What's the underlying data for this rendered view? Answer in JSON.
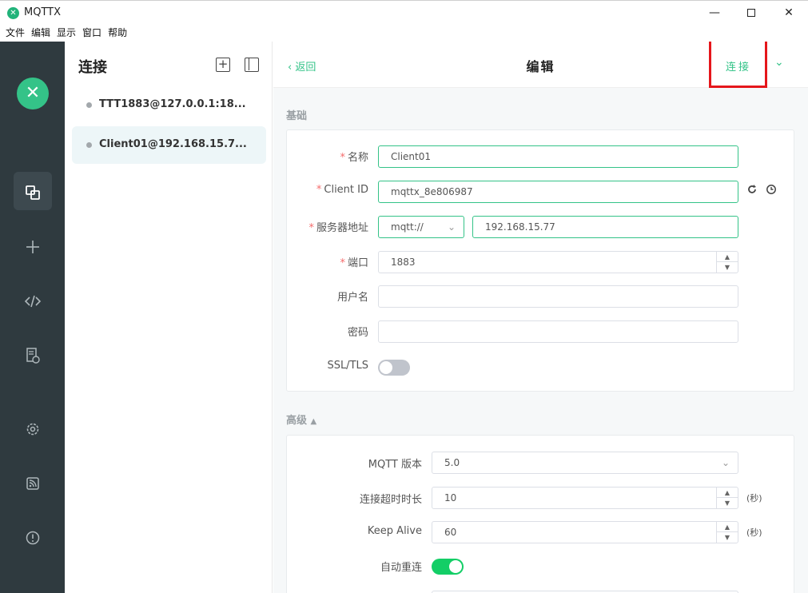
{
  "window": {
    "title": "MQTTX",
    "minimize": "—",
    "close": "✕"
  },
  "menu": [
    "文件",
    "编辑",
    "显示",
    "窗口",
    "帮助"
  ],
  "nav": {
    "brand": "✕"
  },
  "list": {
    "title": "连接",
    "items": [
      {
        "name": "TTT1883@127.0.0.1:18..."
      },
      {
        "name": "Client01@192.168.15.7..."
      }
    ]
  },
  "header": {
    "back": "返回",
    "title": "编辑",
    "connect": "连接"
  },
  "basic": {
    "section": "基础",
    "name_label": "名称",
    "name_value": "Client01",
    "client_id_label": "Client ID",
    "client_id_value": "mqttx_8e806987",
    "host_label": "服务器地址",
    "protocol": "mqtt://",
    "host_value": "192.168.15.77",
    "port_label": "端口",
    "port_value": "1883",
    "username_label": "用户名",
    "username_value": "",
    "password_label": "密码",
    "password_value": "",
    "ssl_label": "SSL/TLS",
    "ssl_on": false
  },
  "advanced": {
    "section": "高级",
    "mqtt_version_label": "MQTT 版本",
    "mqtt_version_value": "5.0",
    "timeout_label": "连接超时时长",
    "timeout_value": "10",
    "timeout_unit": "(秒)",
    "keepalive_label": "Keep Alive",
    "keepalive_value": "60",
    "keepalive_unit": "(秒)",
    "reconnect_label": "自动重连",
    "reconnect_on": true
  },
  "colors": {
    "accent": "#34c388",
    "nav_bg": "#2f3a3f",
    "highlight": "#e5161b",
    "switch_on": "#13ce66"
  }
}
